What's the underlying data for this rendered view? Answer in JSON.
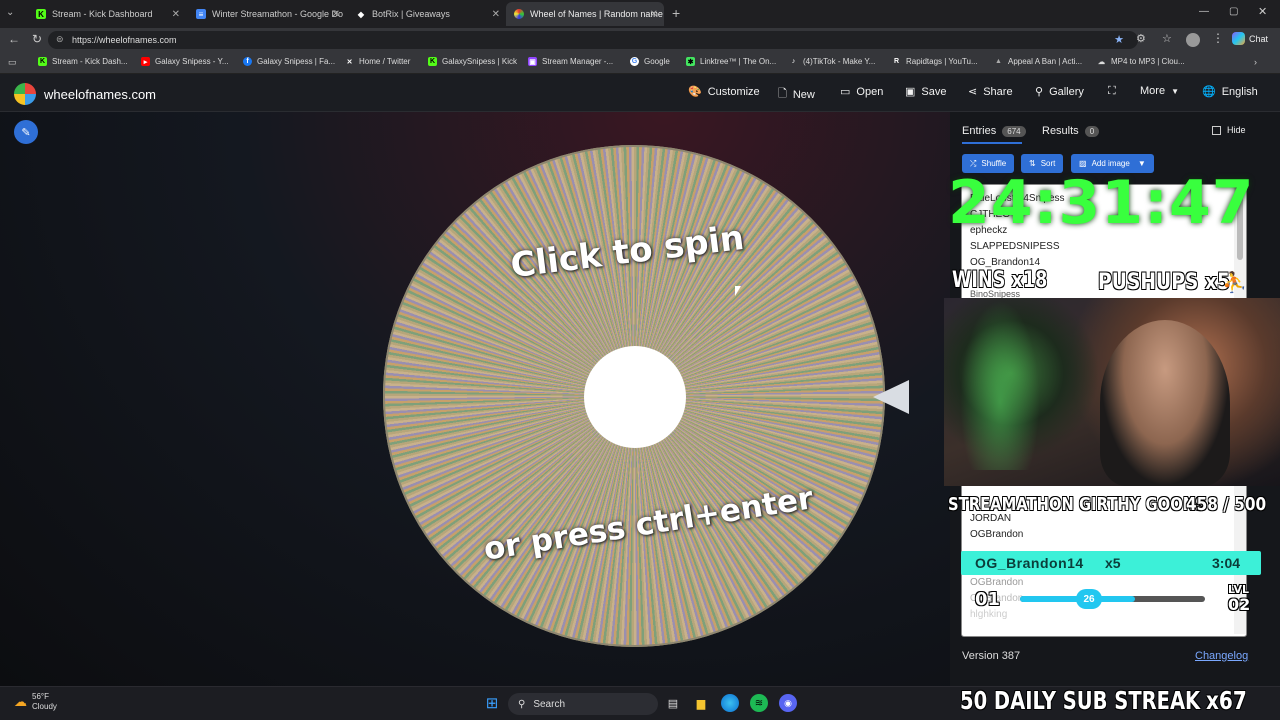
{
  "browser": {
    "tabs": [
      {
        "label": "Stream - Kick Dashboard",
        "icon": "kick-icon"
      },
      {
        "label": "Winter Streamathon - Google Do",
        "icon": "google-docs-icon"
      },
      {
        "label": "BotRix | Giveaways",
        "icon": "botrix-icon"
      },
      {
        "label": "Wheel of Names | Random name",
        "icon": "wheel-icon"
      }
    ],
    "url": "https://wheelofnames.com",
    "chat_label": "Chat",
    "bookmarks": [
      "Stream - Kick Dash...",
      "Galaxy Snipess - Y...",
      "Galaxy Snipess | Fa...",
      "Home / Twitter",
      "GalaxySnipess | Kick",
      "Stream Manager -...",
      "Google",
      "Linktree™ | The On...",
      "(4)TikTok - Make Y...",
      "Rapidtags | YouTu...",
      "Appeal A Ban | Acti...",
      "MP4 to MP3 | Clou..."
    ]
  },
  "app": {
    "site_name": "wheelofnames.com",
    "menu": {
      "customize": "Customize",
      "new": "New",
      "open": "Open",
      "save": "Save",
      "share": "Share",
      "gallery": "Gallery",
      "more": "More",
      "language": "English"
    },
    "wheel": {
      "top_text": "Click to spin",
      "bottom_text": "or press ctrl+enter"
    },
    "panel": {
      "entries_label": "Entries",
      "entries_count": "674",
      "results_label": "Results",
      "results_count": "0",
      "hide_label": "Hide",
      "shuffle": "Shuffle",
      "sort": "Sort",
      "add_image": "Add image",
      "entries": [
        "BlueLobster4Snipess",
        "CJTHEG",
        "epheckz",
        "SLAPPEDSNIPESS",
        "OG_Brandon14",
        "BinoSnipess",
        "JORDAN",
        "OGBrandon",
        "OGBrandon",
        "OGBrandon",
        "hlghking"
      ],
      "version": "Version 387",
      "changelog": "Changelog"
    }
  },
  "overlay": {
    "timer": "24:31:47",
    "wins": "WINS x18",
    "pushups": "PUSHUPS x5",
    "streamathon_title": "STREAMATHON GIRTHY GOONS",
    "streamathon_progress": "458 / 500",
    "sub_user": "OG_Brandon14",
    "sub_mult": "x5",
    "sub_time": "3:04",
    "level_left": "01",
    "level_value": "26",
    "level_fraction": 0.62,
    "lvl_label": "LVL",
    "level_right": "02",
    "sub_streak": "50 DAILY SUB STREAK",
    "sub_streak_count": "x67"
  },
  "taskbar": {
    "weather_temp": "56°F",
    "weather_desc": "Cloudy",
    "search": "Search"
  },
  "colors": {
    "timer_green": "#39ff3e",
    "accent_blue": "#2f6fd6",
    "sub_bar": "#3cf0d8"
  }
}
